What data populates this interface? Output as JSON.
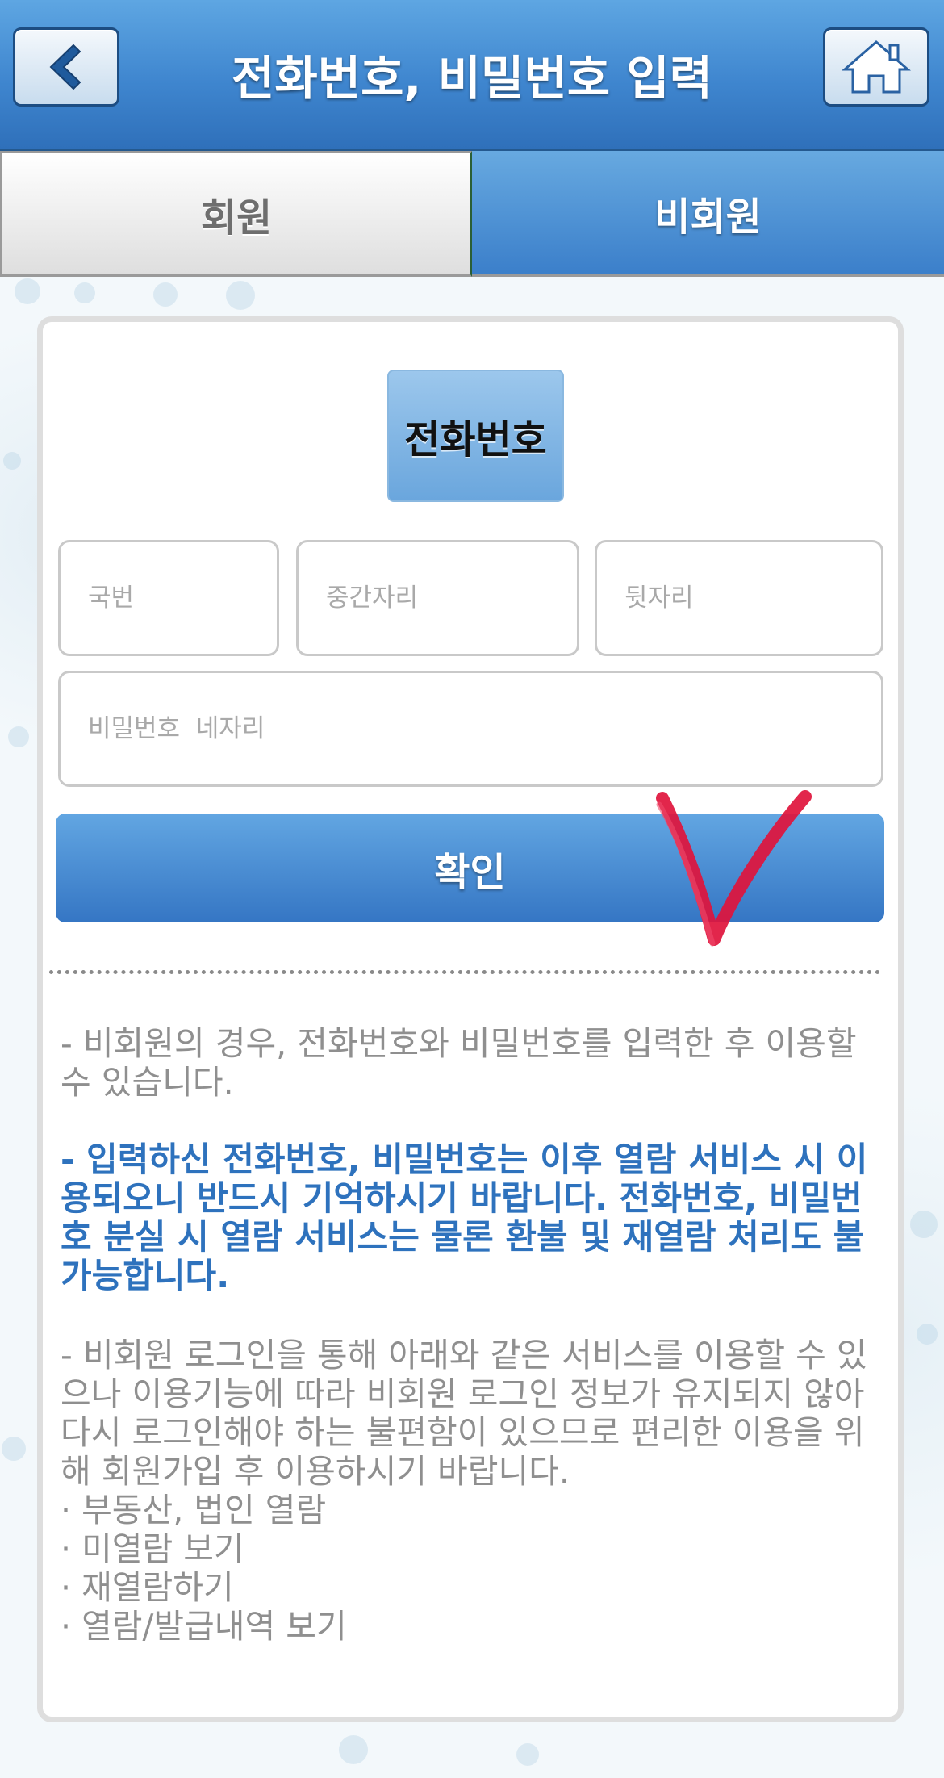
{
  "header": {
    "title": "전화번호, 비밀번호 입력",
    "back_icon": "back-arrow-icon",
    "home_icon": "home-icon"
  },
  "tabs": [
    {
      "label": "회원",
      "active": false
    },
    {
      "label": "비회원",
      "active": true
    }
  ],
  "form": {
    "phone_label": "전화번호",
    "area_code_placeholder": "국번",
    "middle_placeholder": "중간자리",
    "last_placeholder": "뒷자리",
    "password_placeholder": "비밀번호  네자리",
    "confirm_label": "확인"
  },
  "notes": {
    "p1": "- 비회원의 경우, 전화번호와 비밀번호를 입력한 후 이용할 수 있습니다.",
    "p2": "- 입력하신 전화번호, 비밀번호는 이후 열람 서비스 시 이용되오니 반드시 기억하시기 바랍니다. 전화번호, 비밀번호 분실 시 열람 서비스는 물론 환불 및 재열람 처리도 불가능합니다.",
    "p3": "- 비회원 로그인을 통해 아래와 같은 서비스를 이용할 수 있으나 이용기능에 따라 비회원 로그인 정보가 유지되지 않아 다시 로그인해야 하는 불편함이 있으므로 편리한 이용을 위해 회원가입 후 이용하시기 바랍니다.",
    "services": [
      "· 부동산, 법인 열람",
      "· 미열람 보기",
      "· 재열람하기",
      "· 열람/발급내역 보기"
    ]
  },
  "colors": {
    "header_blue": "#3f86cf",
    "accent_blue": "#2e72bd",
    "annotation_red": "#e0133c"
  }
}
